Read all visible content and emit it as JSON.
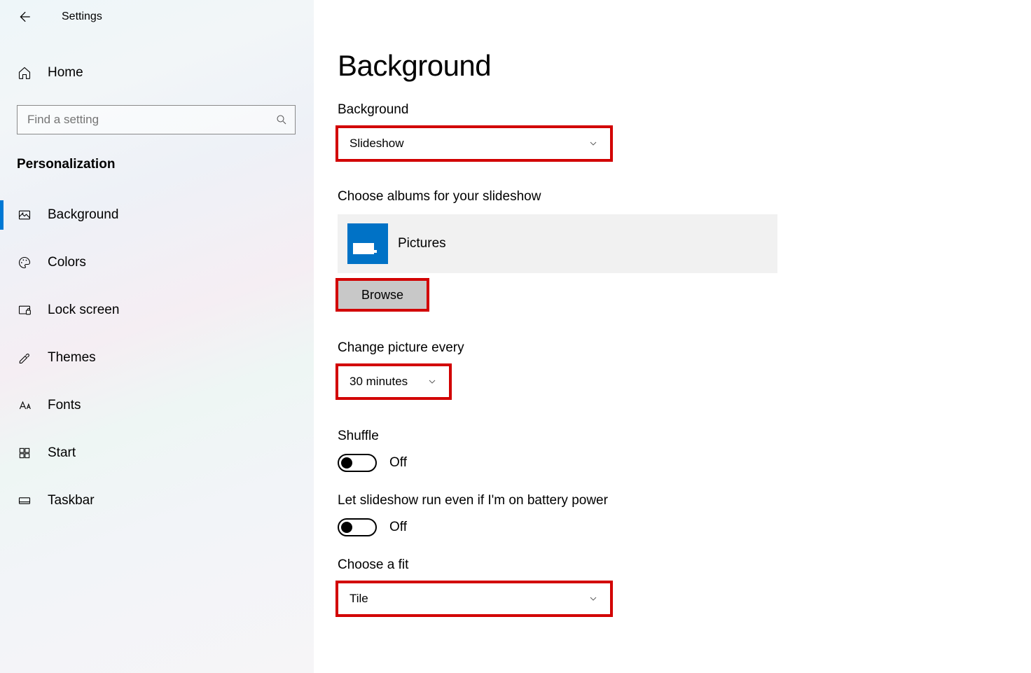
{
  "header": {
    "app_title": "Settings"
  },
  "sidebar": {
    "home_label": "Home",
    "search_placeholder": "Find a setting",
    "category": "Personalization",
    "items": [
      {
        "label": "Background",
        "active": true
      },
      {
        "label": "Colors",
        "active": false
      },
      {
        "label": "Lock screen",
        "active": false
      },
      {
        "label": "Themes",
        "active": false
      },
      {
        "label": "Fonts",
        "active": false
      },
      {
        "label": "Start",
        "active": false
      },
      {
        "label": "Taskbar",
        "active": false
      }
    ]
  },
  "main": {
    "page_title": "Background",
    "background_label": "Background",
    "background_value": "Slideshow",
    "albums_label": "Choose albums for your slideshow",
    "album_name": "Pictures",
    "browse_label": "Browse",
    "interval_label": "Change picture every",
    "interval_value": "30 minutes",
    "shuffle_label": "Shuffle",
    "shuffle_state": "Off",
    "battery_label": "Let slideshow run even if I'm on battery power",
    "battery_state": "Off",
    "fit_label": "Choose a fit",
    "fit_value": "Tile"
  }
}
